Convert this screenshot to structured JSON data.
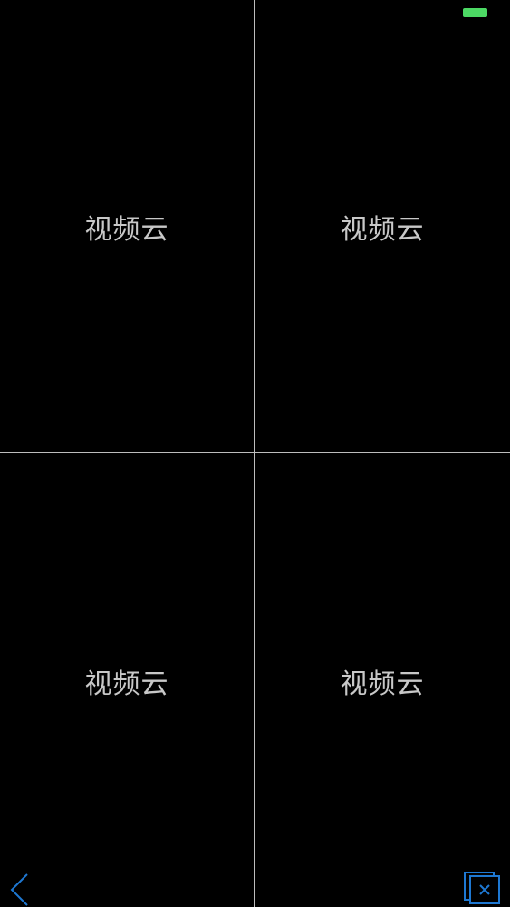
{
  "status_bar": {
    "battery_color": "#4cd964"
  },
  "video_grid": {
    "tiles": [
      {
        "label": "视频云"
      },
      {
        "label": "视频云"
      },
      {
        "label": "视频云"
      },
      {
        "label": "视频云"
      }
    ]
  },
  "toolbar": {
    "back_icon": "chevron-left-icon",
    "close_icon": "close-windows-icon",
    "accent_color": "#1e78d2"
  }
}
